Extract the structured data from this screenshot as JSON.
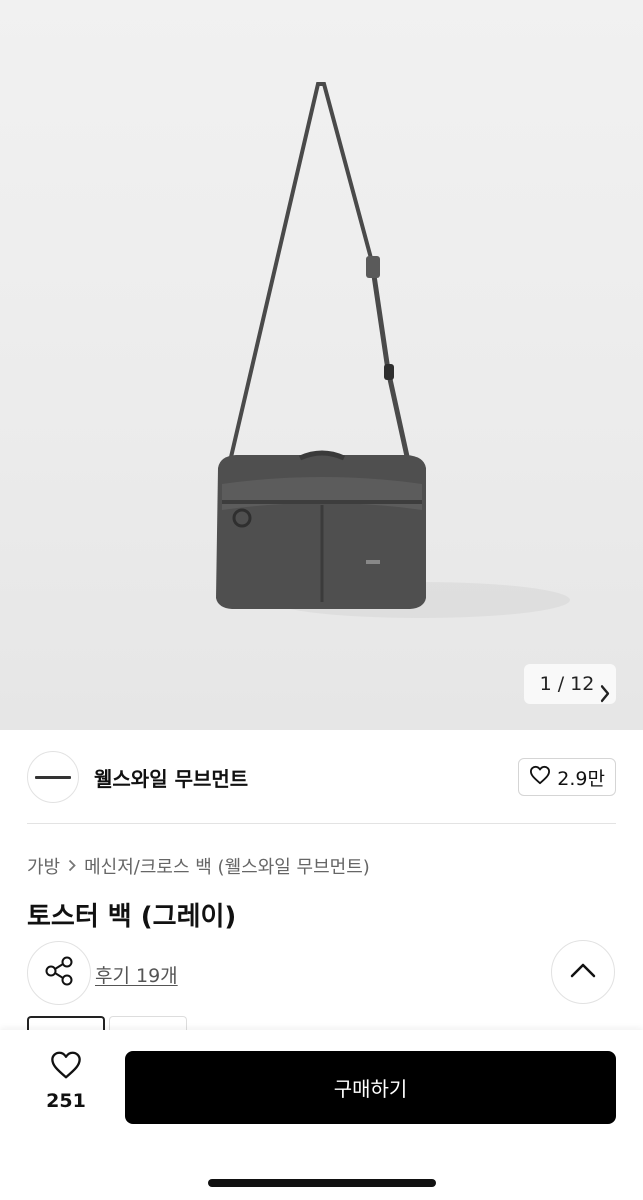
{
  "gallery": {
    "current": "1",
    "separator": "/",
    "total": "12",
    "next_icon": "chevron-right-icon",
    "image_subject": "gray crossbody bag"
  },
  "seller": {
    "name": "웰스와일 무브먼트",
    "likes": "2.9만",
    "like_icon": "heart-outline-icon"
  },
  "breadcrumb": {
    "items": [
      "가방",
      "메신저/크로스 백 (웰스와일 무브먼트)"
    ],
    "separator": ">"
  },
  "product": {
    "title": "토스터 백 (그레이)",
    "reviews_label": "후기 19개"
  },
  "bottom_bar": {
    "like_count": "251",
    "buy_label": "구매하기"
  },
  "colors": {
    "buy_button": "#000000",
    "text_primary": "#111111",
    "text_secondary": "#666666"
  }
}
